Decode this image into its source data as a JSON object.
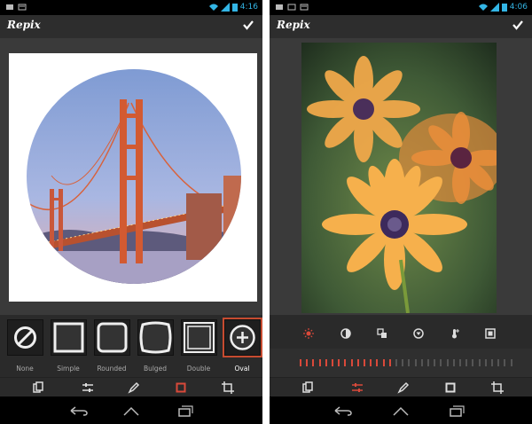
{
  "left_screen": {
    "status": {
      "time": "4:16"
    },
    "app_title": "Repix",
    "frames": [
      {
        "label": "None"
      },
      {
        "label": "Simple"
      },
      {
        "label": "Rounded"
      },
      {
        "label": "Bulged"
      },
      {
        "label": "Double"
      },
      {
        "label": "Oval",
        "selected": true
      }
    ]
  },
  "right_screen": {
    "status": {
      "time": "4:06"
    },
    "app_title": "Repix",
    "slider_ticks_total": 34,
    "slider_ticks_active": 15
  },
  "colors": {
    "accent": "#d9493a",
    "clock": "#33b5e5",
    "background": "#3a3a3a"
  }
}
